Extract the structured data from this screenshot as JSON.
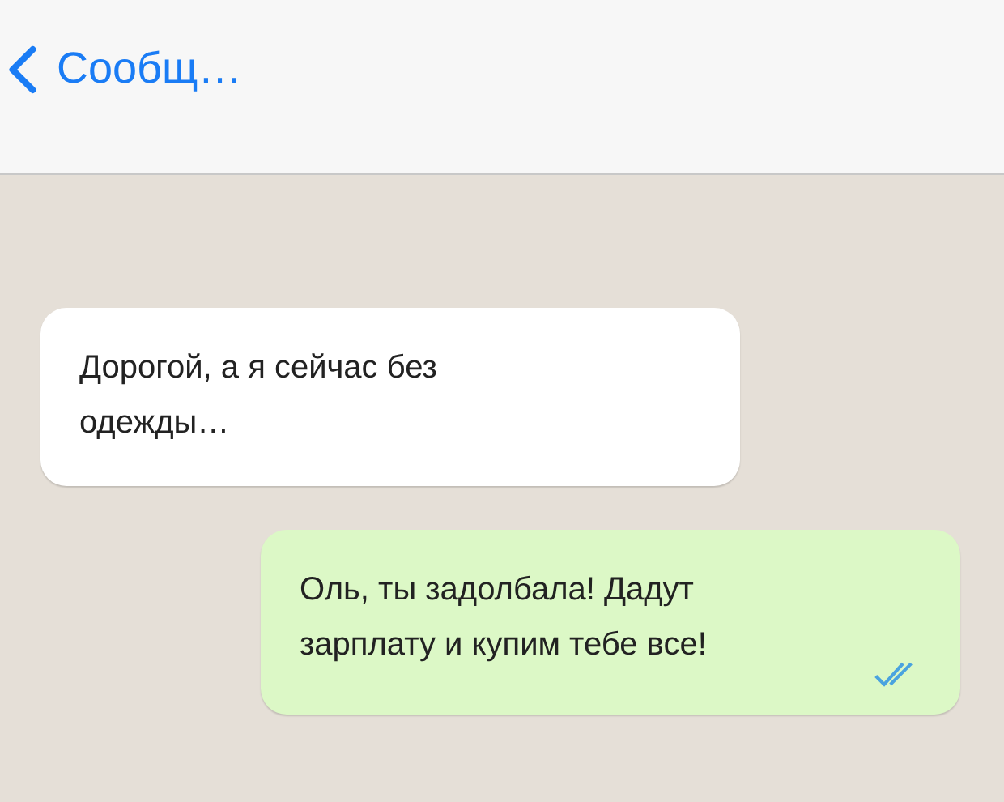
{
  "header": {
    "back_label": "Сообщ…"
  },
  "messages": [
    {
      "kind": "incoming",
      "text": "Дорогой, а я сейчас без одежды…"
    },
    {
      "kind": "outgoing",
      "text": "Оль, ты задолбала! Дадут зарплату и купим тебе все!",
      "read": true
    }
  ]
}
